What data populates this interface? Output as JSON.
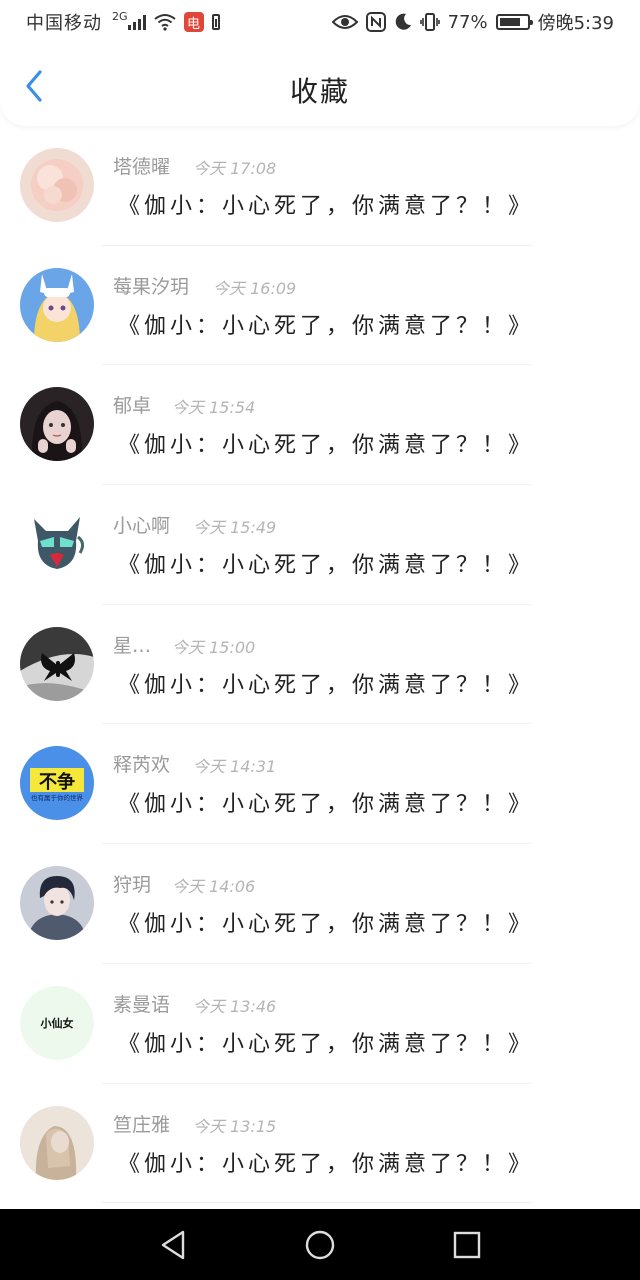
{
  "status_bar": {
    "carrier": "中国移动",
    "net_type": "2G",
    "app_badge": "电",
    "battery_text": "77%",
    "time": "傍晚5:39",
    "battery_level": 0.77
  },
  "header": {
    "title": "收藏"
  },
  "favorites": [
    {
      "name": "塔德曜",
      "time": "今天 17:08",
      "quote": "《伽小：小心死了，你满意了？！》"
    },
    {
      "name": "莓果汐玥",
      "time": "今天 16:09",
      "quote": "《伽小：小心死了，你满意了？！》"
    },
    {
      "name": "郁卓",
      "time": "今天 15:54",
      "quote": "《伽小：小心死了，你满意了？！》"
    },
    {
      "name": "小心啊",
      "time": "今天 15:49",
      "quote": "《伽小：小心死了，你满意了？！》"
    },
    {
      "name": "星…",
      "time": "今天 15:00",
      "quote": "《伽小：小心死了，你满意了？！》"
    },
    {
      "name": "释芮欢",
      "time": "今天 14:31",
      "quote": "《伽小：小心死了，你满意了？！》"
    },
    {
      "name": "狩玥",
      "time": "今天 14:06",
      "quote": "《伽小：小心死了，你满意了？！》"
    },
    {
      "name": "素曼语",
      "time": "今天 13:46",
      "quote": "《伽小：小心死了，你满意了？！》"
    },
    {
      "name": "笪庄雅",
      "time": "今天 13:15",
      "quote": "《伽小：小心死了，你满意了？！》"
    }
  ],
  "avatar_texts": {
    "avatar6_big": "不争",
    "avatar6_small": "也有属于你的世界",
    "avatar8": "小仙女"
  },
  "colors": {
    "accent": "#3a8ee6",
    "name_gray": "#9a9a9a",
    "time_gray": "#b5b5b5",
    "nav_bar": "#000000"
  }
}
